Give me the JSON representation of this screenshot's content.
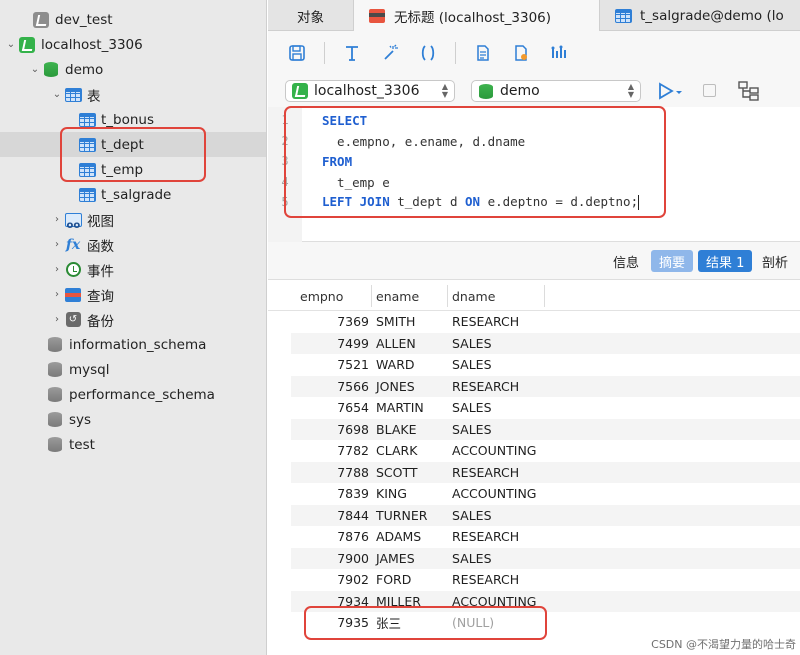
{
  "sidebar": {
    "items": [
      {
        "label": "dev_test"
      },
      {
        "label": "localhost_3306"
      },
      {
        "label": "demo"
      },
      {
        "label": "表"
      },
      {
        "label": "t_bonus"
      },
      {
        "label": "t_dept"
      },
      {
        "label": "t_emp"
      },
      {
        "label": "t_salgrade"
      },
      {
        "label": "视图"
      },
      {
        "label": "函数"
      },
      {
        "label": "事件"
      },
      {
        "label": "查询"
      },
      {
        "label": "备份"
      },
      {
        "label": "information_schema"
      },
      {
        "label": "mysql"
      },
      {
        "label": "performance_schema"
      },
      {
        "label": "sys"
      },
      {
        "label": "test"
      }
    ]
  },
  "tabs": [
    {
      "label": "对象"
    },
    {
      "label": "无标题 (localhost_3306)"
    },
    {
      "label": "t_salgrade@demo (lo"
    }
  ],
  "selectors": {
    "connection": "localhost_3306",
    "database": "demo"
  },
  "editor": {
    "line_numbers": [
      "1",
      "2",
      "3",
      "4",
      "5"
    ],
    "lines": [
      {
        "kw": "SELECT",
        "rest": ""
      },
      {
        "kw": "",
        "rest": "  e.empno, e.ename, d.dname"
      },
      {
        "kw": "FROM",
        "rest": ""
      },
      {
        "kw": "",
        "rest": "  t_emp e"
      },
      {
        "kw": "LEFT JOIN",
        "rest": " t_dept d ",
        "kw2": "ON",
        "rest2": " e.deptno = d.deptno;"
      }
    ]
  },
  "result_tabs": {
    "info": "信息",
    "summary": "摘要",
    "result": "结果 1",
    "profile": "剖析"
  },
  "grid": {
    "headers": [
      "empno",
      "ename",
      "dname"
    ],
    "rows": [
      [
        "7369",
        "SMITH",
        "RESEARCH"
      ],
      [
        "7499",
        "ALLEN",
        "SALES"
      ],
      [
        "7521",
        "WARD",
        "SALES"
      ],
      [
        "7566",
        "JONES",
        "RESEARCH"
      ],
      [
        "7654",
        "MARTIN",
        "SALES"
      ],
      [
        "7698",
        "BLAKE",
        "SALES"
      ],
      [
        "7782",
        "CLARK",
        "ACCOUNTING"
      ],
      [
        "7788",
        "SCOTT",
        "RESEARCH"
      ],
      [
        "7839",
        "KING",
        "ACCOUNTING"
      ],
      [
        "7844",
        "TURNER",
        "SALES"
      ],
      [
        "7876",
        "ADAMS",
        "RESEARCH"
      ],
      [
        "7900",
        "JAMES",
        "SALES"
      ],
      [
        "7902",
        "FORD",
        "RESEARCH"
      ],
      [
        "7934",
        "MILLER",
        "ACCOUNTING"
      ],
      [
        "7935",
        "张三",
        "(NULL)"
      ]
    ]
  },
  "watermark": "CSDN @不渴望力量的哈士奇",
  "colors": {
    "accent": "#2f7fd6",
    "highlight_box": "#e0443b",
    "connection_green": "#34b24a"
  },
  "icons": {
    "toolbar": [
      "save-icon",
      "format-icon",
      "beautify-icon",
      "code-brackets-icon",
      "text-file-icon",
      "export-icon",
      "explain-icon"
    ]
  }
}
